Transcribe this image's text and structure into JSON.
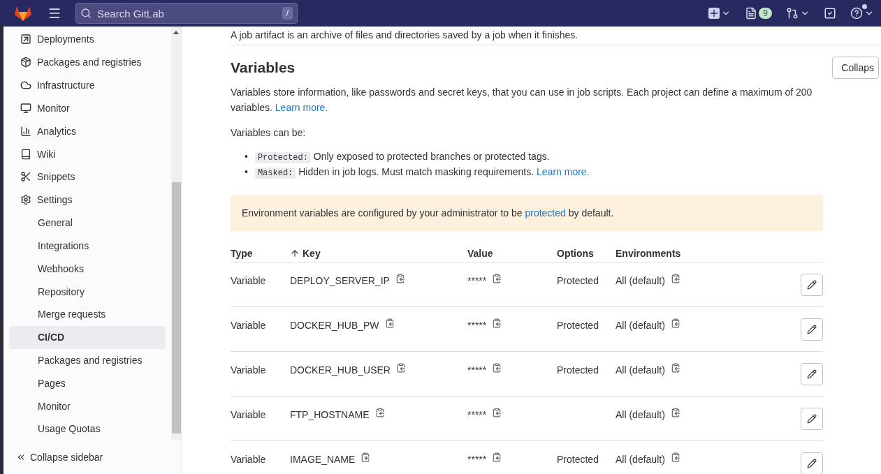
{
  "header": {
    "search": {
      "placeholder": "Search GitLab",
      "shortcut": "/"
    },
    "issues_badge": "9"
  },
  "sidebar": {
    "items": [
      {
        "label": "Deployments",
        "kind": "section",
        "selected": false
      },
      {
        "label": "Packages and registries",
        "kind": "section",
        "selected": false
      },
      {
        "label": "Infrastructure",
        "kind": "section",
        "selected": false
      },
      {
        "label": "Monitor",
        "kind": "section",
        "selected": false
      },
      {
        "label": "Analytics",
        "kind": "section",
        "selected": false
      },
      {
        "label": "Wiki",
        "kind": "section",
        "selected": false
      },
      {
        "label": "Snippets",
        "kind": "section",
        "selected": false
      },
      {
        "label": "Settings",
        "kind": "section",
        "selected": false
      },
      {
        "label": "General",
        "kind": "subitem",
        "selected": false
      },
      {
        "label": "Integrations",
        "kind": "subitem",
        "selected": false
      },
      {
        "label": "Webhooks",
        "kind": "subitem",
        "selected": false
      },
      {
        "label": "Repository",
        "kind": "subitem",
        "selected": false
      },
      {
        "label": "Merge requests",
        "kind": "subitem",
        "selected": false
      },
      {
        "label": "CI/CD",
        "kind": "subitem",
        "selected": true
      },
      {
        "label": "Packages and registries",
        "kind": "subitem",
        "selected": false
      },
      {
        "label": "Pages",
        "kind": "subitem",
        "selected": false
      },
      {
        "label": "Monitor",
        "kind": "subitem",
        "selected": false
      },
      {
        "label": "Usage Quotas",
        "kind": "subitem",
        "selected": false
      }
    ],
    "collapse": "Collapse sidebar"
  },
  "content": {
    "previous_text": "A job artifact is an archive of files and directories saved by a job when it finishes.",
    "title": "Variables",
    "collapse_button": "Collaps",
    "intro": {
      "text": "Variables store information, like passwords and secret keys, that you can use in job scripts. Each project can define a maximum of 200 variables.",
      "link": "Learn more."
    },
    "list_intro": "Variables can be:",
    "bullets": [
      {
        "marker": "•",
        "code": "Protected:",
        "text": "Only exposed to protected branches or protected tags."
      },
      {
        "marker": "•",
        "code": "Masked:",
        "text": "Hidden in job logs. Must match masking requirements.",
        "link": "Learn more."
      }
    ],
    "alert": {
      "text": "Environment variables are configured by your administrator to be",
      "link": "protected",
      "text_after": "by default."
    },
    "table": {
      "columns": [
        "Type",
        "Key",
        "Value",
        "Options",
        "Environments"
      ],
      "rows": [
        {
          "type": "Variable",
          "key": "DEPLOY_SERVER_IP",
          "value": "*****",
          "options": "Protected",
          "environment": "All (default)"
        },
        {
          "type": "Variable",
          "key": "DOCKER_HUB_PW",
          "value": "*****",
          "options": "Protected",
          "environment": "All (default)"
        },
        {
          "type": "Variable",
          "key": "DOCKER_HUB_USER",
          "value": "*****",
          "options": "Protected",
          "environment": "All (default)"
        },
        {
          "type": "Variable",
          "key": "FTP_HOSTNAME",
          "value": "*****",
          "environment": "All (default)"
        },
        {
          "type": "Variable",
          "key": "IMAGE_NAME",
          "value": "*****",
          "options": "Protected",
          "environment": "All (default)"
        }
      ]
    }
  }
}
